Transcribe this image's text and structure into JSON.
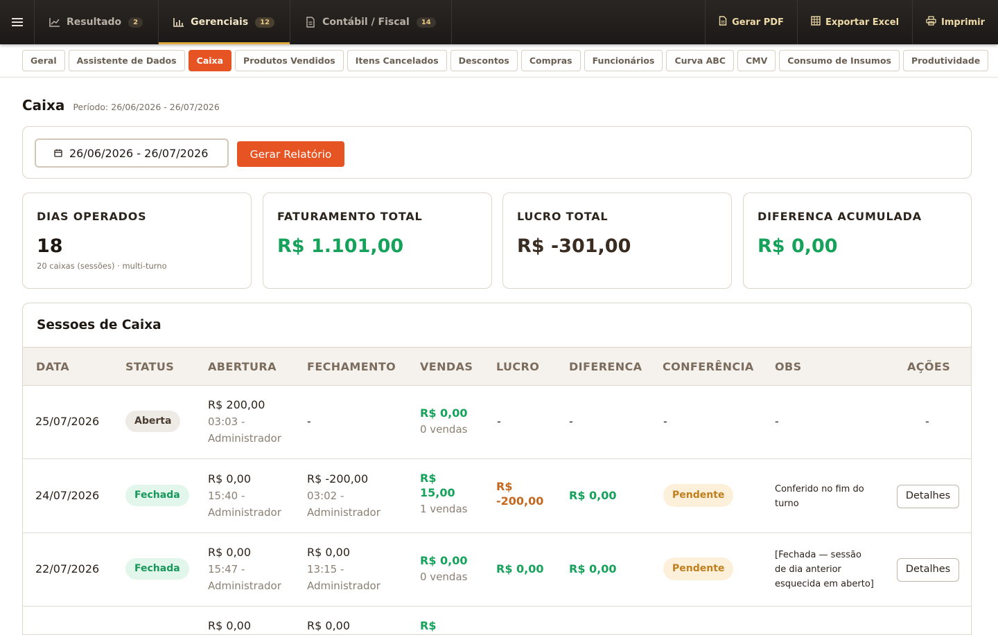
{
  "topbar": {
    "tabs": [
      {
        "label": "Resultado",
        "count": "2"
      },
      {
        "label": "Gerenciais",
        "count": "12"
      },
      {
        "label": "Contábil / Fiscal",
        "count": "14"
      }
    ],
    "actions": {
      "pdf": "Gerar PDF",
      "excel": "Exportar Excel",
      "print": "Imprimir"
    }
  },
  "subtabs": [
    "Geral",
    "Assistente de Dados",
    "Caixa",
    "Produtos Vendidos",
    "Itens Cancelados",
    "Descontos",
    "Compras",
    "Funcionários",
    "Curva ABC",
    "CMV",
    "Consumo de Insumos",
    "Produtividade"
  ],
  "page": {
    "title": "Caixa",
    "period": "Período: 26/06/2026 - 26/07/2026"
  },
  "filter": {
    "date_range": "26/06/2026 - 26/07/2026",
    "generate_label": "Gerar Relatório"
  },
  "kpis": [
    {
      "label": "DIAS OPERADOS",
      "value": "18",
      "sub": "20 caixas (sessões) · multi-turno"
    },
    {
      "label": "FATURAMENTO TOTAL",
      "value": "R$ 1.101,00"
    },
    {
      "label": "LUCRO TOTAL",
      "value": "R$ -301,00"
    },
    {
      "label": "DIFERENCA ACUMULADA",
      "value": "R$ 0,00"
    }
  ],
  "sessions": {
    "title": "Sessoes de Caixa",
    "columns": [
      "DATA",
      "STATUS",
      "ABERTURA",
      "FECHAMENTO",
      "VENDAS",
      "LUCRO",
      "DIFERENCA",
      "CONFERÊNCIA",
      "OBS",
      "AÇÕES"
    ],
    "rows": [
      {
        "date": "25/07/2026",
        "status": "Aberta",
        "open_value": "R$ 200,00",
        "open_meta": "03:03 - Administrador",
        "close": "-",
        "sales_value": "R$ 0,00",
        "sales_count": "0 vendas",
        "profit": "-",
        "diff": "-",
        "check": "-",
        "obs": "-",
        "action": "-"
      },
      {
        "date": "24/07/2026",
        "status": "Fechada",
        "open_value": "R$ 0,00",
        "open_meta": "15:40 - Administrador",
        "close_value": "R$ -200,00",
        "close_meta": "03:02 - Administrador",
        "sales_value_a": "R$",
        "sales_value_b": "15,00",
        "sales_count": "1 vendas",
        "profit_a": "R$",
        "profit_b": "-200,00",
        "diff": "R$ 0,00",
        "check": "Pendente",
        "obs": "Conferido no fim do turno",
        "action": "Detalhes"
      },
      {
        "date": "22/07/2026",
        "status": "Fechada",
        "open_value": "R$ 0,00",
        "open_meta": "15:47 - Administrador",
        "close_value": "R$ 0,00",
        "close_meta": "13:15 - Administrador",
        "sales_value": "R$ 0,00",
        "sales_count": "0 vendas",
        "profit": "R$ 0,00",
        "diff": "R$ 0,00",
        "check": "Pendente",
        "obs": "[Fechada — sessão de dia anterior esquecida em aberto]",
        "action": "Detalhes"
      },
      {
        "open_value": "R$ 0,00",
        "close_value": "R$ 0,00",
        "sales_value_a": "R$"
      }
    ]
  }
}
